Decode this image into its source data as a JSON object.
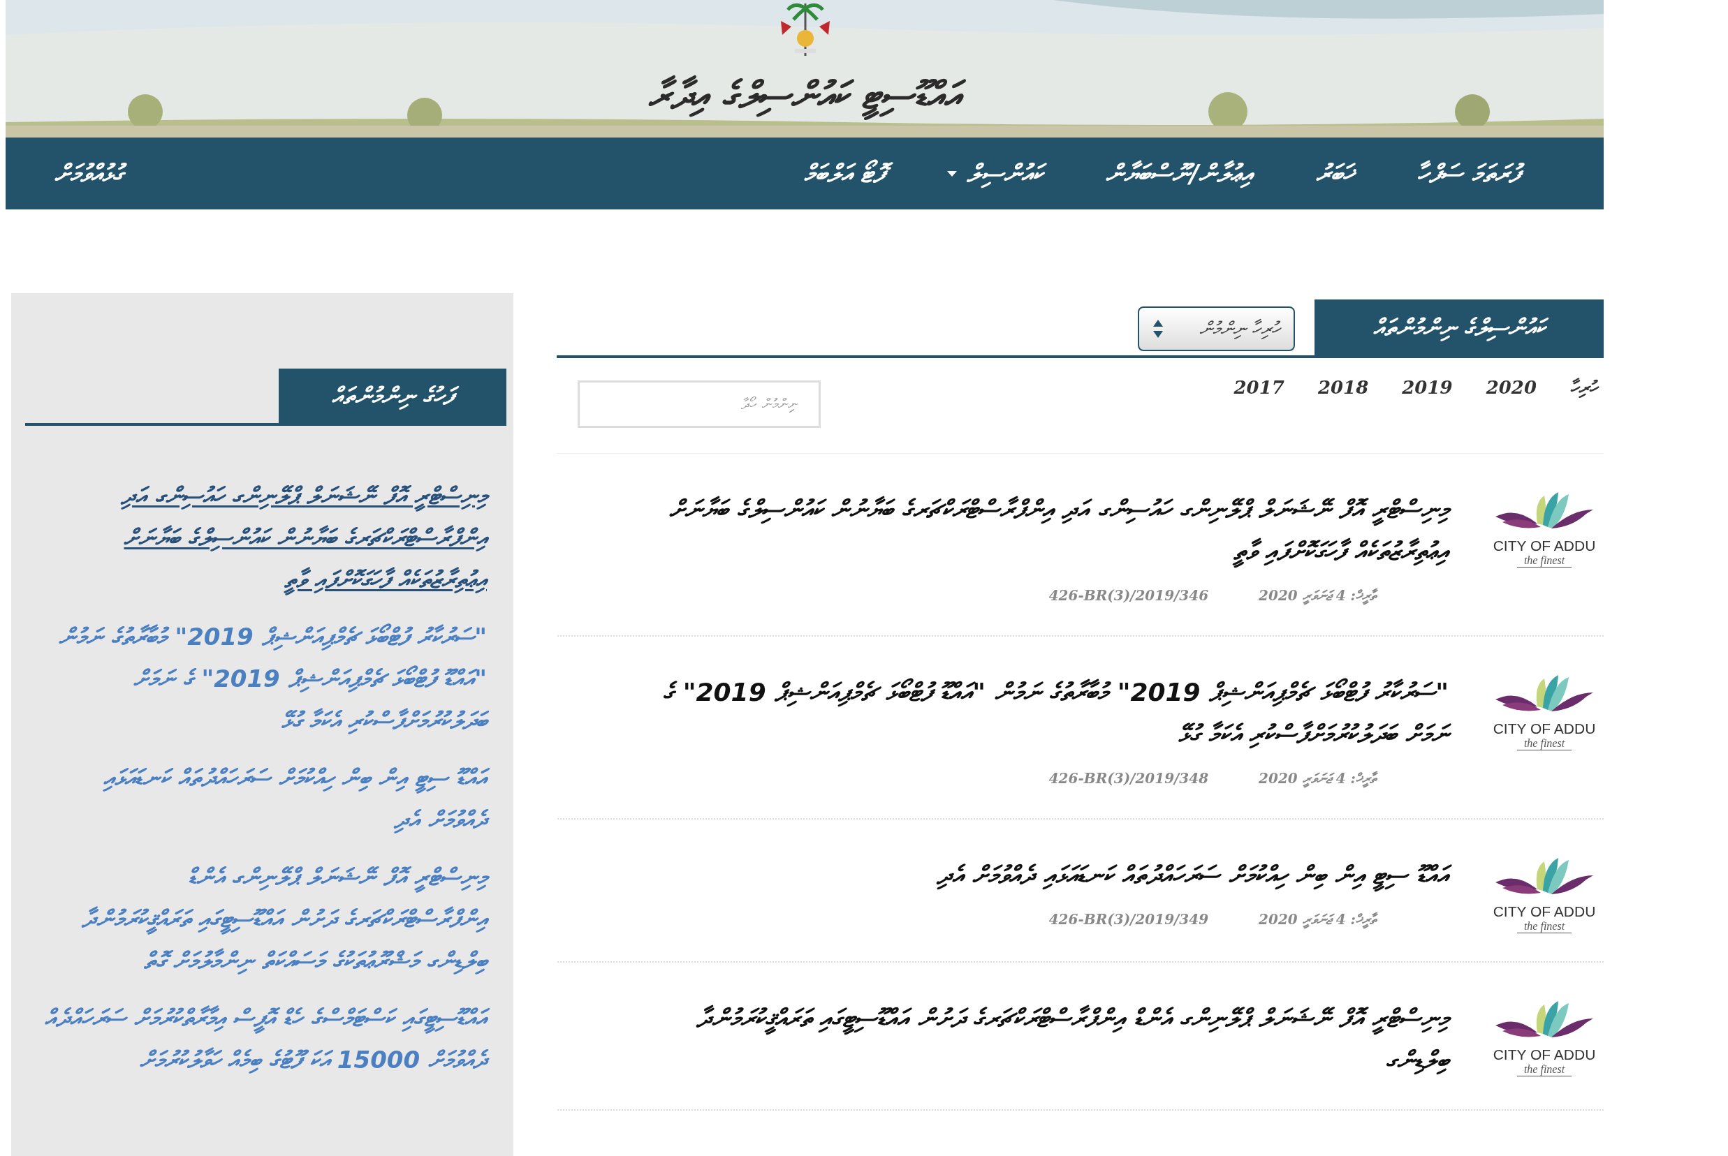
{
  "header": {
    "title": "އައްޑޫސިޓީ ކައުންސިލްގެ އިދާރާ"
  },
  "nav": {
    "items": [
      {
        "label": "ފުރަތަމަ ސަފްހާ",
        "dropdown": false
      },
      {
        "label": "ޚަބަރު",
        "dropdown": false
      },
      {
        "label": "އިޢުލާން/ނޫސްބަޔާން",
        "dropdown": false
      },
      {
        "label": "ކައުންސިލް",
        "dropdown": true
      },
      {
        "label": "ފޮޓޯ އަލްބަމް",
        "dropdown": false
      }
    ],
    "contact": "ގުޅުއްވުމަށް"
  },
  "main": {
    "tab": "ކައުންސިލްގެ ނިންމުންތައް",
    "select": "ހުރިހާ ނިންމުން",
    "years": [
      "ހުރިހާ",
      "2020",
      "2019",
      "2018",
      "2017"
    ],
    "search": {
      "placeholder": "ނިންމުން ހޯދާ"
    },
    "decisions": [
      {
        "title": "މިނިސްޓްރީ އޮފް ނޭޝަނަލް ޕްލޭނިންގ ހައުސިންގ އަދި އިންފްރާސްޓްރަކްޗަރގެ ބަޔާނުން ކައުންސިލްގެ ބަޔާނަށް އިޢުތިރާޒުތަކެއް ފާހަގަކޮށްފައި ވާތީ",
        "date": "ތާރީޚް: 4 ޖަނަވަރީ 2020",
        "ref": "426-BR(3)/2019/346",
        "logo": "CITY OF ADDU",
        "tagline": "the finest"
      },
      {
        "title": "\"ސަރުކާރު ފުޓްބޯޅަ ޗެމްޕިއަންޝިޕް 2019\" މުބާރާތުގެ ނަމުން \"އައްޑޫ ފުޓްބޯޅަ ޗެމްޕިއަންޝިޕް 2019\" ގެ ނަމަށް ބަދަލުކުރުމަށްފާސްކުރި އެކަމާ ގުޅޭ",
        "date": "ތާރީޚް: 4 ޖަނަވަރީ 2020",
        "ref": "426-BR(3)/2019/348",
        "logo": "CITY OF ADDU",
        "tagline": "the finest"
      },
      {
        "title": "އައްޑޫ ސިޓީ އިން ބިން ހިއްކުމަށް ސަރަހައްދުތައް ކަނޑައަޅައި ދެއްވުމަށް އެދި",
        "date": "ތާރީޚް: 4 ޖަނަވަރީ 2020",
        "ref": "426-BR(3)/2019/349",
        "logo": "CITY OF ADDU",
        "tagline": "the finest"
      },
      {
        "title": "މިނިސްޓްރީ އޮފް ނޭޝަނަލް ޕްލޭނިންގ އެންޑް އިންފްރާސްޓްރަކްޗަރގެ ދަށުން އައްޑޫސިޓީގައި ތަރައްޤީކުރަމުންދާ ބިލްޑިންގ",
        "logo": "CITY OF ADDU",
        "tagline": "the finest"
      }
    ]
  },
  "sidebar": {
    "title": "ފަހުގެ ނިންމުންތައް",
    "items": [
      {
        "text": "މިނިސްޓްރީ އޮފް ނޭޝަނަލް ޕްލޭނިންގ ހައުސިންގ އަދި އިންފްރާސްޓްރަކްޗަރގެ ބަޔާނުން ކައުންސިލްގެ ބަޔާނަށް އިޢުތިރާޒުތަކެއް ފާހަގަކޮށްފައި ވާތީ",
        "underlined": true
      },
      {
        "text": "\"ސަރުކާރު ފުޓްބޯޅަ ޗެމްޕިއަންޝިޕް 2019\" މުބާރާތުގެ ނަމުން \"އައްޑޫ ފުޓްބޯޅަ ޗެމްޕިއަންޝިޕް 2019\" ގެ ނަމަށް ބަދަލުކުރުމަށްފާސްކުރި އެކަމާ ގުޅޭ",
        "underlined": false
      },
      {
        "text": "އައްޑޫ ސިޓީ އިން ބިން ހިއްކުމަށް ސަރަހައްދުތައް ކަނޑައަޅައި ދެއްވުމަށް އެދި",
        "underlined": false
      },
      {
        "text": "މިނިސްޓްރީ އޮފް ނޭޝަނަލް ޕްލޭނިންގ އެންޑް އިންފްރާސްޓްރަކްޗަރގެ ދަށުން އައްޑޫސިޓީގައި ތަރައްޤީކުރަމުންދާ ބިލްޑިންގ މަޝްރޫޢުތަކުގެ މަސައްކަތް ނިންމާލުމަށް ގޮތް",
        "underlined": false
      },
      {
        "text": "އައްޑޫސިޓީގައި ކަސްޓަމްސްގެ ހެޑް އޮފީސް އިމާރާތްކުރުމަށް ސަރަހައްދެއް ދެއްވުމަށް 15000 އަކަ ފޫޓުގެ ބިމެއް ހަވާލުކުރުމަށް",
        "underlined": false
      }
    ]
  }
}
